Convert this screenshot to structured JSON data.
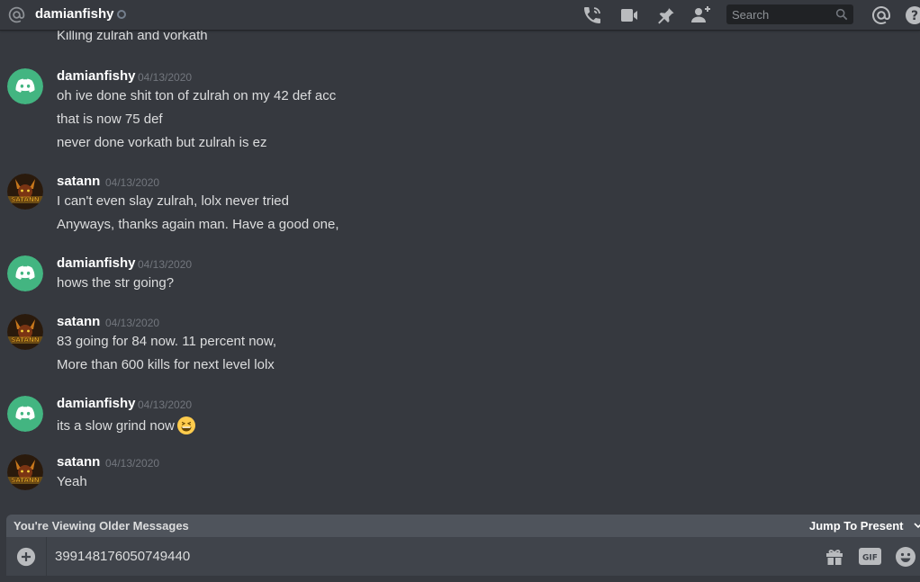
{
  "header": {
    "title": "damianfishy",
    "search_placeholder": "Search",
    "icons": [
      "at-icon",
      "call-icon",
      "video-icon",
      "pin-icon",
      "add-friend-icon",
      "search-icon",
      "mentions-icon",
      "help-icon"
    ]
  },
  "messages": {
    "cut_off_line": "Killing zulrah and vorkath",
    "groups": [
      {
        "author": "damianfishy",
        "timestamp": "04/13/2020",
        "avatar": "discord-default-avatar",
        "lines": [
          "oh ive done shit ton of zulrah on my 42 def acc",
          "that is now 75 def",
          "never done vorkath but zulrah is ez"
        ]
      },
      {
        "author": "satann",
        "timestamp": "04/13/2020",
        "avatar": "satann-avatar",
        "avatar_text": "SATANN",
        "lines": [
          "I can't even slay zulrah, lolx never tried",
          "Anyways, thanks again man. Have a good one,"
        ]
      },
      {
        "author": "damianfishy",
        "timestamp": "04/13/2020",
        "avatar": "discord-default-avatar",
        "lines": [
          "hows the str going?"
        ]
      },
      {
        "author": "satann",
        "timestamp": "04/13/2020",
        "avatar": "satann-avatar",
        "avatar_text": "SATANN",
        "lines": [
          "83 going for 84 now. 11 percent now,",
          "More than 600 kills for next level lolx"
        ]
      },
      {
        "author": "damianfishy",
        "timestamp": "04/13/2020",
        "avatar": "discord-default-avatar",
        "lines": [
          "its a slow grind now"
        ],
        "emoji": "grinning-emoji"
      },
      {
        "author": "satann",
        "timestamp": "04/13/2020",
        "avatar": "satann-avatar",
        "avatar_text": "SATANN",
        "lines": [
          "Yeah"
        ]
      }
    ]
  },
  "older_bar": {
    "label": "You're Viewing Older Messages",
    "jump_label": "Jump To Present"
  },
  "composer": {
    "value": "399148176050749440",
    "gif_label": "GIF"
  },
  "colors": {
    "background": "#36393f",
    "discord_green": "#43b581",
    "timestamp": "#72767d",
    "older_bar": "#4f545c",
    "composer": "#40444b"
  }
}
